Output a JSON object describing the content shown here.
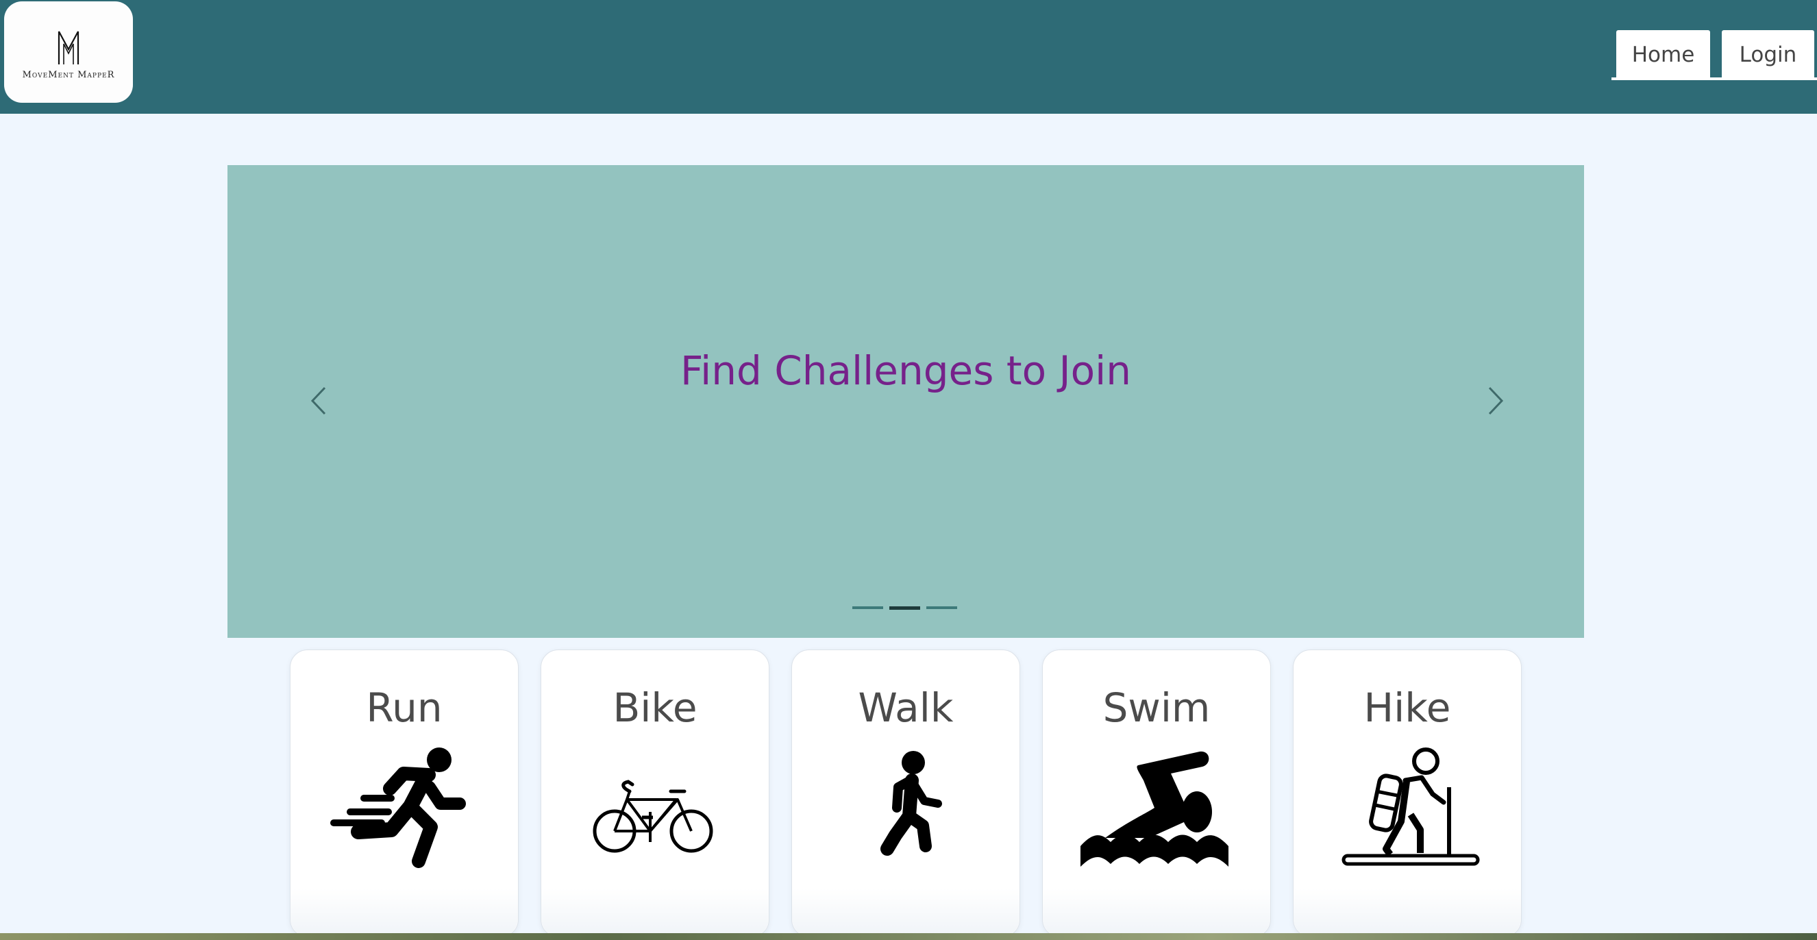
{
  "header": {
    "logo_letter": "M",
    "logo_text": "MoveMent MappeR",
    "nav": {
      "home_label": "Home",
      "login_label": "Login"
    }
  },
  "carousel": {
    "caption": "Find Challenges to Join",
    "slides_count": 3,
    "active_slide": 2
  },
  "activities": [
    {
      "label": "Run",
      "icon": "running-icon"
    },
    {
      "label": "Bike",
      "icon": "bicycle-icon"
    },
    {
      "label": "Walk",
      "icon": "walking-icon"
    },
    {
      "label": "Swim",
      "icon": "swimming-icon"
    },
    {
      "label": "Hike",
      "icon": "hiking-icon"
    }
  ],
  "colors": {
    "header_bg": "#2e6b76",
    "page_bg": "#eff6fe",
    "carousel_bg": "#93c3bf",
    "caption_color": "#76218a"
  }
}
